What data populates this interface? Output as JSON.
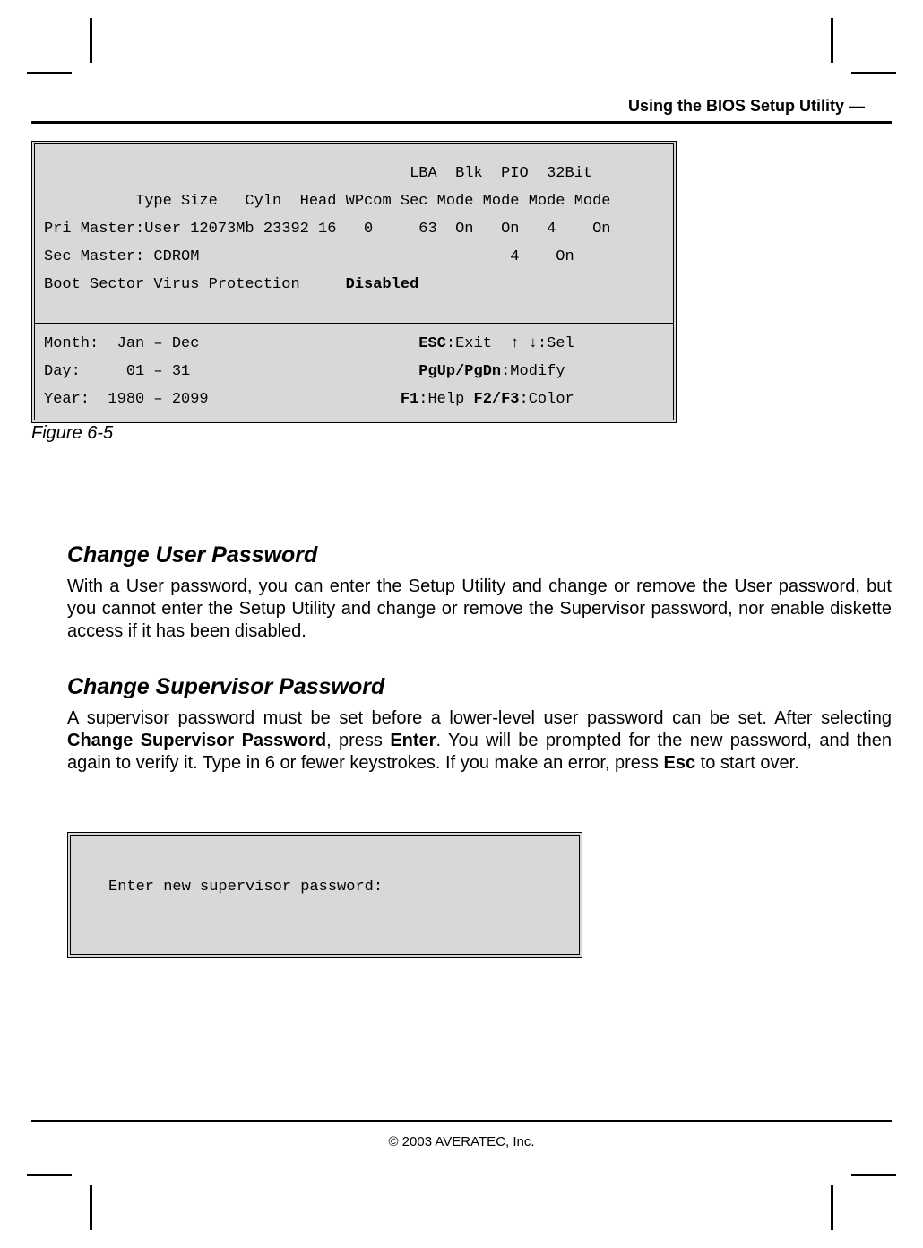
{
  "header": {
    "running_head_bold": "Using the BIOS Setup Utility",
    "running_head_suffix": " —"
  },
  "bios": {
    "l1": "                                        LBA  Blk  PIO  32Bit",
    "l2": "          Type Size   Cyln  Head WPcom Sec Mode Mode Mode Mode",
    "l3": "Pri Master:User 12073Mb 23392 16   0     63  On   On   4    On",
    "l4": "Sec Master: CDROM                                  4    On",
    "l5": "",
    "l6a": "Boot Sector Virus Protection     ",
    "l6b": "Disabled",
    "r1a": "Month:  Jan – Dec                        ",
    "r1b": "ESC",
    "r1c": ":Exit  ",
    "r1_arrow_up": "↑",
    "r1_space": " ",
    "r1_arrow_down": "↓",
    "r1d": ":Sel",
    "r2a": "Day:     01 – 31                         ",
    "r2b": "PgUp/PgDn",
    "r2c": ":Modify",
    "r3a": "Year:  1980 – 2099                     ",
    "r3b": "F1",
    "r3c": ":Help ",
    "r3d": "F2/F3",
    "r3e": ":Color"
  },
  "figure_caption": "Figure 6-5",
  "section1": {
    "heading": "Change User Password",
    "para": "With a User password, you can enter the Setup Utility and change or remove the User password, but you cannot enter the Setup Utility and change or remove the Supervisor password, nor enable diskette access if it has been disabled."
  },
  "section2": {
    "heading": "Change Supervisor Password",
    "p_a": "A supervisor password must be set before a lower-level user password can be set. After selecting ",
    "p_b": "Change Supervisor Password",
    "p_c": ", press ",
    "p_d": "Enter",
    "p_e": ". You will be prompted for the new password, and then again to verify it. Type in 6 or fewer keystrokes. If you make an error, press ",
    "p_f": "Esc",
    "p_g": " to start over."
  },
  "prompt": {
    "text": "Enter new supervisor password:"
  },
  "footer": {
    "text": "© 2003 AVERATEC, Inc."
  }
}
